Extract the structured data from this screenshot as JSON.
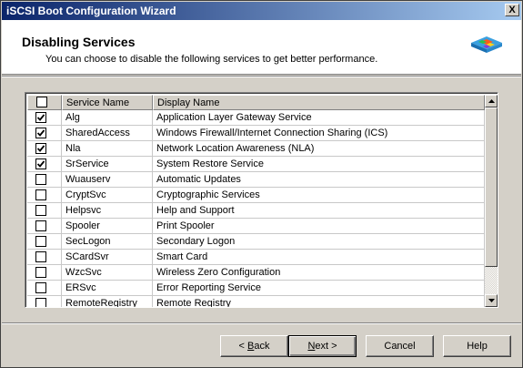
{
  "window": {
    "title": "iSCSI Boot Configuration Wizard",
    "close_glyph": "X"
  },
  "header": {
    "title": "Disabling Services",
    "subtitle": "You can choose to disable the following services to get better performance.",
    "logo_icon": "cube-icon"
  },
  "table": {
    "columns": [
      "",
      "Service Name",
      "Display Name"
    ],
    "header_checked": false,
    "rows": [
      {
        "checked": true,
        "service": "Alg",
        "display": "Application Layer Gateway Service"
      },
      {
        "checked": true,
        "service": "SharedAccess",
        "display": "Windows Firewall/Internet Connection Sharing (ICS)"
      },
      {
        "checked": true,
        "service": "Nla",
        "display": "Network Location Awareness (NLA)"
      },
      {
        "checked": true,
        "service": "SrService",
        "display": "System Restore Service"
      },
      {
        "checked": false,
        "service": "Wuauserv",
        "display": "Automatic Updates"
      },
      {
        "checked": false,
        "service": "CryptSvc",
        "display": "Cryptographic Services"
      },
      {
        "checked": false,
        "service": "Helpsvc",
        "display": "Help and Support"
      },
      {
        "checked": false,
        "service": "Spooler",
        "display": "Print Spooler"
      },
      {
        "checked": false,
        "service": "SecLogon",
        "display": "Secondary Logon"
      },
      {
        "checked": false,
        "service": "SCardSvr",
        "display": "Smart Card"
      },
      {
        "checked": false,
        "service": "WzcSvc",
        "display": "Wireless Zero Configuration"
      },
      {
        "checked": false,
        "service": "ERSvc",
        "display": "Error Reporting Service"
      },
      {
        "checked": false,
        "service": "RemoteRegistry",
        "display": "Remote Registry"
      }
    ]
  },
  "buttons": {
    "back": {
      "before": "< ",
      "mnemonic": "B",
      "after": "ack"
    },
    "next": {
      "before": "",
      "mnemonic": "N",
      "after": "ext >"
    },
    "cancel": "Cancel",
    "help": "Help"
  }
}
